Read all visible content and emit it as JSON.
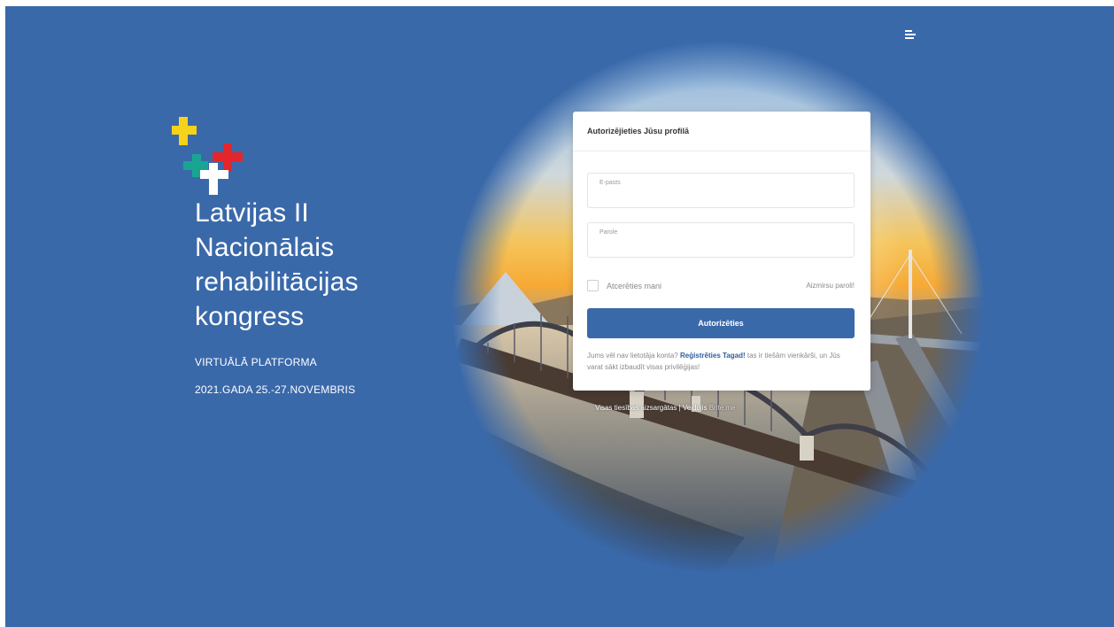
{
  "header": {
    "menu_icon": "menu-icon"
  },
  "brand": {
    "title": "Latvijas II\nNacionālais\nrehabilitācijas\nkongress",
    "subtitle": "VIRTUĀLĀ PLATFORMA",
    "dates": "2021.GADA 25.-27.NOVEMBRIS",
    "logo_colors": {
      "yellow": "#f7d21a",
      "teal": "#18a693",
      "red": "#e3262c",
      "white": "#ffffff"
    }
  },
  "login": {
    "heading": "Autorizējieties Jūsu profilā",
    "email_label": "E-pasts",
    "email_value": "",
    "password_label": "Parole",
    "password_value": "",
    "remember_label": "Atcerēties mani",
    "forgot_link": "Aizmirsu paroli!",
    "submit_label": "Autorizēties",
    "register_prefix": "Jums vēl nav lietotāja konta?",
    "register_link": "Reģistrēties Tagad!",
    "register_suffix": "tas ir tiešām vienkārši, un Jūs varat sākt izbaudīt visas privilēģijas!"
  },
  "footer": {
    "prefix": "Visas tiesības aizsargātas | Veidojis",
    "credit": "Brite.me"
  },
  "colors": {
    "background": "#3a69aa",
    "accent": "#3a69aa",
    "link": "#2d5d9f"
  }
}
